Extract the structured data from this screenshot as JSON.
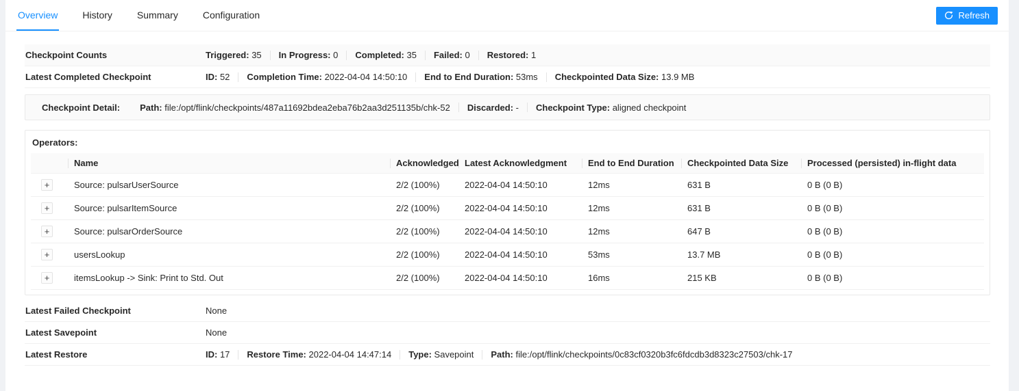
{
  "colors": {
    "accent": "#1890ff",
    "row_alt_bg": "#fafafa",
    "border": "#f0f0f0"
  },
  "tabs": [
    {
      "label": "Overview",
      "active": true
    },
    {
      "label": "History",
      "active": false
    },
    {
      "label": "Summary",
      "active": false
    },
    {
      "label": "Configuration",
      "active": false
    }
  ],
  "refresh_button": {
    "label": "Refresh",
    "icon": "reload-icon"
  },
  "overview_rows": [
    {
      "label": "Checkpoint Counts",
      "items": [
        {
          "key": "Triggered:",
          "value": "35"
        },
        {
          "key": "In Progress:",
          "value": "0"
        },
        {
          "key": "Completed:",
          "value": "35"
        },
        {
          "key": "Failed:",
          "value": "0"
        },
        {
          "key": "Restored:",
          "value": "1"
        }
      ]
    },
    {
      "label": "Latest Completed Checkpoint",
      "items": [
        {
          "key": "ID:",
          "value": "52"
        },
        {
          "key": "Completion Time:",
          "value": "2022-04-04 14:50:10"
        },
        {
          "key": "End to End Duration:",
          "value": "53ms"
        },
        {
          "key": "Checkpointed Data Size:",
          "value": "13.9 MB"
        }
      ]
    }
  ],
  "checkpoint_detail": {
    "label": "Checkpoint Detail:",
    "items": [
      {
        "key": "Path:",
        "value": "file:/opt/flink/checkpoints/487a11692bdea2eba76b2aa3d251135b/chk-52"
      },
      {
        "key": "Discarded:",
        "value": "-"
      },
      {
        "key": "Checkpoint Type:",
        "value": "aligned checkpoint"
      }
    ]
  },
  "operators": {
    "label": "Operators:",
    "expand_symbol": "+",
    "columns": [
      "Name",
      "Acknowledged",
      "Latest Acknowledgment",
      "End to End Duration",
      "Checkpointed Data Size",
      "Processed (persisted) in-flight data"
    ],
    "rows": [
      [
        "Source: pulsarUserSource",
        "2/2 (100%)",
        "2022-04-04 14:50:10",
        "12ms",
        "631 B",
        "0 B (0 B)"
      ],
      [
        "Source: pulsarItemSource",
        "2/2 (100%)",
        "2022-04-04 14:50:10",
        "12ms",
        "631 B",
        "0 B (0 B)"
      ],
      [
        "Source: pulsarOrderSource",
        "2/2 (100%)",
        "2022-04-04 14:50:10",
        "12ms",
        "647 B",
        "0 B (0 B)"
      ],
      [
        "usersLookup",
        "2/2 (100%)",
        "2022-04-04 14:50:10",
        "53ms",
        "13.7 MB",
        "0 B (0 B)"
      ],
      [
        "itemsLookup -> Sink: Print to Std. Out",
        "2/2 (100%)",
        "2022-04-04 14:50:10",
        "16ms",
        "215 KB",
        "0 B (0 B)"
      ]
    ]
  },
  "footer_rows": [
    {
      "label": "Latest Failed Checkpoint",
      "items": [
        {
          "key": "",
          "value": "None"
        }
      ]
    },
    {
      "label": "Latest Savepoint",
      "items": [
        {
          "key": "",
          "value": "None"
        }
      ]
    },
    {
      "label": "Latest Restore",
      "items": [
        {
          "key": "ID:",
          "value": "17"
        },
        {
          "key": "Restore Time:",
          "value": "2022-04-04 14:47:14"
        },
        {
          "key": "Type:",
          "value": "Savepoint"
        },
        {
          "key": "Path:",
          "value": "file:/opt/flink/checkpoints/0c83cf0320b3fc6fdcdb3d8323c27503/chk-17"
        }
      ]
    }
  ]
}
